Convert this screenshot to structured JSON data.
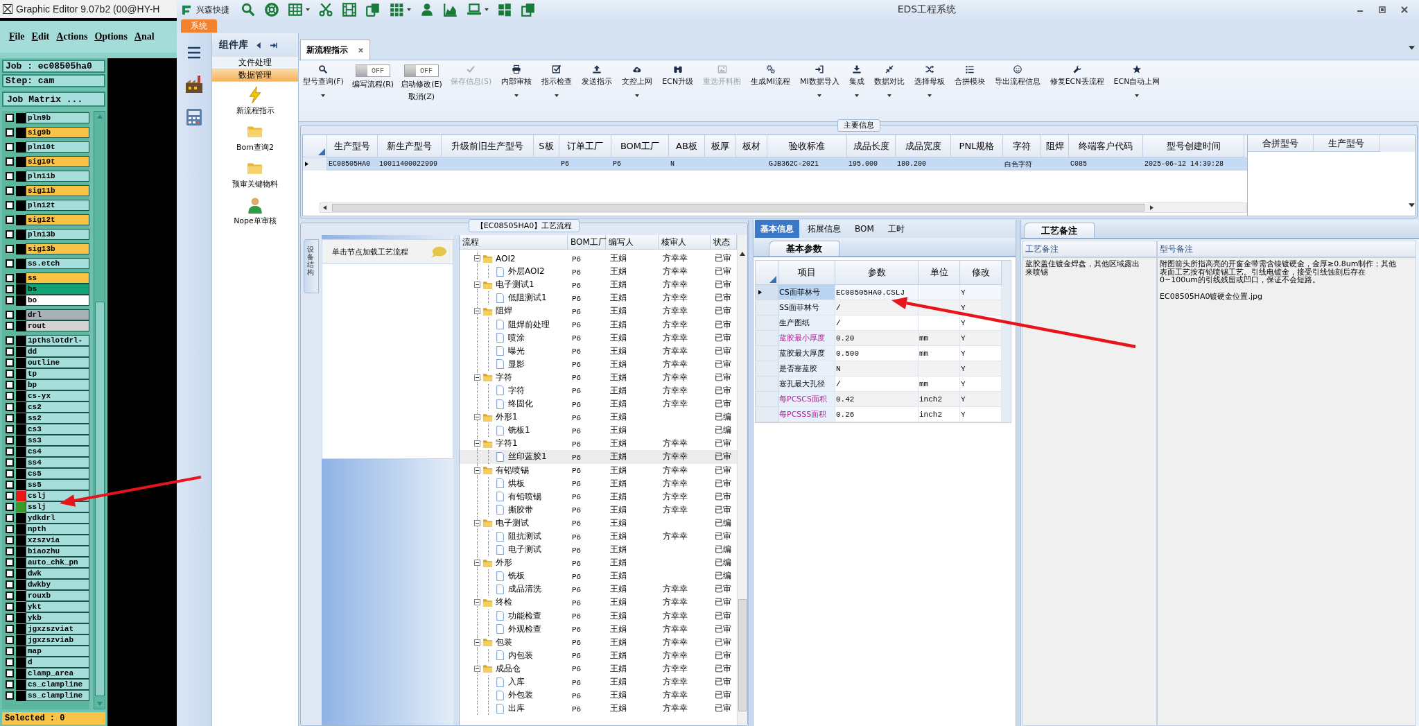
{
  "editor": {
    "title": "Graphic Editor 9.07b2 (00@HY-H",
    "menu": [
      "File",
      "Edit",
      "Actions",
      "Options",
      "Anal"
    ],
    "job": "Job : ec08505ha0",
    "step": "Step: cam",
    "matrix_button": "Job Matrix ...",
    "layer_groups": [
      [
        {
          "name": "pln9b",
          "color": "#a6dedb",
          "checked": false
        }
      ],
      [
        {
          "name": "sig9b",
          "color": "#fbc447",
          "checked": false
        }
      ],
      [
        {
          "name": "pln10t",
          "color": "#a6dedb",
          "checked": false
        }
      ],
      [
        {
          "name": "sig10t",
          "color": "#fbc447",
          "checked": false
        }
      ],
      [
        {
          "name": "pln11b",
          "color": "#a6dedb",
          "checked": false
        }
      ],
      [
        {
          "name": "sig11b",
          "color": "#fbc447",
          "checked": false
        }
      ],
      [
        {
          "name": "pln12t",
          "color": "#a6dedb",
          "checked": false
        }
      ],
      [
        {
          "name": "sig12t",
          "color": "#fbc447",
          "checked": false
        }
      ],
      [
        {
          "name": "pln13b",
          "color": "#a6dedb",
          "checked": false
        }
      ],
      [
        {
          "name": "sig13b",
          "color": "#fbc447",
          "checked": false
        }
      ],
      [
        {
          "name": "ss.etch",
          "color": "#a6dedb",
          "checked": false
        }
      ],
      [
        {
          "name": "ss",
          "color": "#fbc447",
          "checked": false
        },
        {
          "name": "bs",
          "color": "#12a273",
          "checked": false
        },
        {
          "name": "bo",
          "color": "#ffffff",
          "checked": false
        }
      ],
      [
        {
          "name": "drl",
          "color": "#a8b2b6",
          "checked": false
        },
        {
          "name": "rout",
          "color": "#d3d3d3",
          "checked": false
        }
      ],
      [
        {
          "name": "1pthslotdrl-",
          "color": "#a6dedb",
          "checked": false
        },
        {
          "name": "dd",
          "color": "#a6dedb",
          "checked": false
        },
        {
          "name": "outline",
          "color": "#a6dedb",
          "checked": false
        },
        {
          "name": "tp",
          "color": "#a6dedb",
          "checked": false
        },
        {
          "name": "bp",
          "color": "#a6dedb",
          "checked": false
        },
        {
          "name": "cs-yx",
          "color": "#a6dedb",
          "checked": false
        },
        {
          "name": "cs2",
          "color": "#a6dedb",
          "checked": false
        },
        {
          "name": "ss2",
          "color": "#a6dedb",
          "checked": false
        },
        {
          "name": "cs3",
          "color": "#a6dedb",
          "checked": false
        },
        {
          "name": "ss3",
          "color": "#a6dedb",
          "checked": false
        },
        {
          "name": "cs4",
          "color": "#a6dedb",
          "checked": false
        },
        {
          "name": "ss4",
          "color": "#a6dedb",
          "checked": false
        },
        {
          "name": "cs5",
          "color": "#a6dedb",
          "checked": false
        },
        {
          "name": "ss5",
          "color": "#a6dedb",
          "checked": false
        },
        {
          "name": "cslj",
          "color": "#a6dedb",
          "checked": false,
          "swatch": {
            "color": "#e81818"
          }
        },
        {
          "name": "sslj",
          "color": "#a6dedb",
          "checked": false,
          "swatch": {
            "color": "#3c9a28"
          }
        },
        {
          "name": "ydkdrl",
          "color": "#a6dedb",
          "checked": false
        },
        {
          "name": "npth",
          "color": "#a6dedb",
          "checked": false
        },
        {
          "name": "xzszvia",
          "color": "#a6dedb",
          "checked": false
        },
        {
          "name": "biaozhu",
          "color": "#a6dedb",
          "checked": false
        },
        {
          "name": "auto_chk_pn",
          "color": "#a6dedb",
          "checked": false
        },
        {
          "name": "dwk",
          "color": "#a6dedb",
          "checked": false
        },
        {
          "name": "dwkby",
          "color": "#a6dedb",
          "checked": false
        },
        {
          "name": "rouxb",
          "color": "#a6dedb",
          "checked": false
        },
        {
          "name": "ykt",
          "color": "#a6dedb",
          "checked": false
        },
        {
          "name": "ykb",
          "color": "#a6dedb",
          "checked": false
        },
        {
          "name": "jgxzszviat",
          "color": "#a6dedb",
          "checked": false
        },
        {
          "name": "jgxzszviab",
          "color": "#a6dedb",
          "checked": false
        },
        {
          "name": "map",
          "color": "#a6dedb",
          "checked": false
        },
        {
          "name": "d",
          "color": "#a6dedb",
          "checked": false
        },
        {
          "name": "clamp_area",
          "color": "#a6dedb",
          "checked": false
        },
        {
          "name": "cs_clampline",
          "color": "#a6dedb",
          "checked": false
        },
        {
          "name": "ss_clampline",
          "color": "#a6dedb",
          "checked": false
        }
      ]
    ],
    "status": "Selected : 0"
  },
  "app": {
    "brand": "兴森快捷",
    "title": "EDS工程系统",
    "menu_tab": "系统"
  },
  "library": {
    "title": "组件库",
    "groups": [
      {
        "label": "文件处理",
        "selected": false
      },
      {
        "label": "数据管理",
        "selected": true
      }
    ],
    "items": [
      {
        "label": "新流程指示"
      },
      {
        "label": "Bom查询2"
      },
      {
        "label": "预审关键物料"
      },
      {
        "label": "Nope单审核"
      }
    ]
  },
  "doc_tab": {
    "label": "新流程指示",
    "selected": true
  },
  "toolbar": [
    {
      "kind": "button",
      "label": "型号查询(F)",
      "dropdown": true,
      "disabled": false
    },
    {
      "kind": "toggle",
      "toggle_text": "OFF",
      "on": false,
      "label": "编写流程(R)"
    },
    {
      "kind": "toggle",
      "toggle_text": "OFF",
      "on": false,
      "label": "启动修改(E)",
      "sublabel": "取消(Z)"
    },
    {
      "kind": "button",
      "label": "保存信息(S)",
      "dropdown": false,
      "disabled": true
    },
    {
      "kind": "button",
      "label": "内部审核",
      "dropdown": true,
      "disabled": false
    },
    {
      "kind": "button",
      "label": "指示检查",
      "dropdown": true,
      "disabled": false
    },
    {
      "kind": "button",
      "label": "发送指示",
      "dropdown": false,
      "disabled": false
    },
    {
      "kind": "button",
      "label": "文控上网",
      "dropdown": true,
      "disabled": false
    },
    {
      "kind": "button",
      "label": "ECN升级",
      "dropdown": false,
      "disabled": false
    },
    {
      "kind": "button",
      "label": "重选开料图",
      "dropdown": false,
      "disabled": true
    },
    {
      "kind": "button",
      "label": "生成MI流程",
      "dropdown": false,
      "disabled": false
    },
    {
      "kind": "button",
      "label": "MI数据导入",
      "dropdown": true,
      "disabled": false
    },
    {
      "kind": "button",
      "label": "集成",
      "dropdown": true,
      "disabled": false
    },
    {
      "kind": "button",
      "label": "数据对比",
      "dropdown": true,
      "disabled": false
    },
    {
      "kind": "button",
      "label": "选择母板",
      "dropdown": true,
      "disabled": false
    },
    {
      "kind": "button",
      "label": "合拼模块",
      "dropdown": false,
      "disabled": false
    },
    {
      "kind": "button",
      "label": "导出流程信息",
      "dropdown": false,
      "disabled": false
    },
    {
      "kind": "button",
      "label": "修复ECN丢流程",
      "dropdown": false,
      "disabled": false
    },
    {
      "kind": "button",
      "label": "ECN自动上网",
      "dropdown": true,
      "disabled": false
    }
  ],
  "main_info": {
    "title": "主要信息",
    "columns": [
      "生产型号",
      "新生产型号",
      "升级前旧生产型号",
      "S板",
      "订单工厂",
      "BOM工厂",
      "AB板",
      "板厚",
      "板材",
      "验收标准",
      "成品长度",
      "成品宽度",
      "PNL规格",
      "字符",
      "阻焊",
      "终端客户代码",
      "型号创建时间"
    ],
    "rows": [
      {
        "selected": true,
        "cells": [
          "EC08505HA0",
          "10011400022999",
          null,
          null,
          "P6",
          "P6",
          "N",
          null,
          null,
          "GJB362C-2021",
          "195.000",
          "180.200",
          null,
          "白色字符",
          null,
          "C085",
          "2025-06-12 14:39:28"
        ]
      }
    ],
    "side_columns": [
      "合拼型号",
      "生产型号"
    ]
  },
  "process": {
    "title": "【EC08505HA0】工艺流程",
    "side_tab": "设备结构",
    "hint": "单击节点加载工艺流程",
    "columns": [
      "流程",
      "BOM工厂",
      "编写人",
      "核审人",
      "状态"
    ],
    "nodes": [
      {
        "name": "AOI2",
        "bom": "P6",
        "writer": "王娟",
        "reviewer": "方幸幸",
        "status": "已审",
        "expanded": true,
        "selected": false,
        "children": [
          {
            "name": "外层AOI2",
            "bom": "P6",
            "writer": "王娟",
            "reviewer": "方幸幸",
            "status": "已审",
            "selected": false
          }
        ]
      },
      {
        "name": "电子测试1",
        "bom": "P6",
        "writer": "王娟",
        "reviewer": "方幸幸",
        "status": "已审",
        "expanded": true,
        "selected": false,
        "children": [
          {
            "name": "低阻测试1",
            "bom": "P6",
            "writer": "王娟",
            "reviewer": "方幸幸",
            "status": "已审",
            "selected": false
          }
        ]
      },
      {
        "name": "阻焊",
        "bom": "P6",
        "writer": "王娟",
        "reviewer": "方幸幸",
        "status": "已审",
        "expanded": true,
        "selected": false,
        "children": [
          {
            "name": "阻焊前处理",
            "bom": "P6",
            "writer": "王娟",
            "reviewer": "方幸幸",
            "status": "已审",
            "selected": false
          },
          {
            "name": "喷涂",
            "bom": "P6",
            "writer": "王娟",
            "reviewer": "方幸幸",
            "status": "已审",
            "selected": false
          },
          {
            "name": "曝光",
            "bom": "P6",
            "writer": "王娟",
            "reviewer": "方幸幸",
            "status": "已审",
            "selected": false
          },
          {
            "name": "显影",
            "bom": "P6",
            "writer": "王娟",
            "reviewer": "方幸幸",
            "status": "已审",
            "selected": false
          }
        ]
      },
      {
        "name": "字符",
        "bom": "P6",
        "writer": "王娟",
        "reviewer": "方幸幸",
        "status": "已审",
        "expanded": true,
        "selected": false,
        "children": [
          {
            "name": "字符",
            "bom": "P6",
            "writer": "王娟",
            "reviewer": "方幸幸",
            "status": "已审",
            "selected": false
          },
          {
            "name": "终固化",
            "bom": "P6",
            "writer": "王娟",
            "reviewer": "方幸幸",
            "status": "已审",
            "selected": false
          }
        ]
      },
      {
        "name": "外形1",
        "bom": "P6",
        "writer": "王娟",
        "status": "已编",
        "expanded": true,
        "selected": false,
        "children": [
          {
            "name": "铣板1",
            "bom": "P6",
            "writer": "王娟",
            "status": "已编",
            "selected": false
          }
        ]
      },
      {
        "name": "字符1",
        "bom": "P6",
        "writer": "王娟",
        "reviewer": "方幸幸",
        "status": "已审",
        "expanded": true,
        "selected": false,
        "children": [
          {
            "name": "丝印蓝胶1",
            "bom": "P6",
            "writer": "王娟",
            "reviewer": "方幸幸",
            "status": "已审",
            "selected": true
          }
        ]
      },
      {
        "name": "有铅喷锡",
        "bom": "P6",
        "writer": "王娟",
        "reviewer": "方幸幸",
        "status": "已审",
        "expanded": true,
        "selected": false,
        "children": [
          {
            "name": "烘板",
            "bom": "P6",
            "writer": "王娟",
            "reviewer": "方幸幸",
            "status": "已审",
            "selected": false
          },
          {
            "name": "有铅喷锡",
            "bom": "P6",
            "writer": "王娟",
            "reviewer": "方幸幸",
            "status": "已审",
            "selected": false
          },
          {
            "name": "撕胶带",
            "bom": "P6",
            "writer": "王娟",
            "reviewer": "方幸幸",
            "status": "已审",
            "selected": false
          }
        ]
      },
      {
        "name": "电子测试",
        "bom": "P6",
        "writer": "王娟",
        "status": "已编",
        "expanded": true,
        "selected": false,
        "children": [
          {
            "name": "阻抗测试",
            "bom": "P6",
            "writer": "王娟",
            "reviewer": "方幸幸",
            "status": "已审",
            "selected": false
          },
          {
            "name": "电子测试",
            "bom": "P6",
            "writer": "王娟",
            "status": "已编",
            "selected": false
          }
        ]
      },
      {
        "name": "外形",
        "bom": "P6",
        "writer": "王娟",
        "status": "已编",
        "expanded": true,
        "selected": false,
        "children": [
          {
            "name": "铣板",
            "bom": "P6",
            "writer": "王娟",
            "status": "已编",
            "selected": false
          },
          {
            "name": "成品清洗",
            "bom": "P6",
            "writer": "王娟",
            "reviewer": "方幸幸",
            "status": "已审",
            "selected": false
          }
        ]
      },
      {
        "name": "终检",
        "bom": "P6",
        "writer": "王娟",
        "reviewer": "方幸幸",
        "status": "已审",
        "expanded": true,
        "selected": false,
        "children": [
          {
            "name": "功能检查",
            "bom": "P6",
            "writer": "王娟",
            "reviewer": "方幸幸",
            "status": "已审",
            "selected": false
          },
          {
            "name": "外观检查",
            "bom": "P6",
            "writer": "王娟",
            "reviewer": "方幸幸",
            "status": "已审",
            "selected": false
          }
        ]
      },
      {
        "name": "包装",
        "bom": "P6",
        "writer": "王娟",
        "reviewer": "方幸幸",
        "status": "已审",
        "expanded": true,
        "selected": false,
        "children": [
          {
            "name": "内包装",
            "bom": "P6",
            "writer": "王娟",
            "reviewer": "方幸幸",
            "status": "已审",
            "selected": false
          }
        ]
      },
      {
        "name": "成品仓",
        "bom": "P6",
        "writer": "王娟",
        "reviewer": "方幸幸",
        "status": "已审",
        "expanded": true,
        "selected": false,
        "children": [
          {
            "name": "入库",
            "bom": "P6",
            "writer": "王娟",
            "reviewer": "方幸幸",
            "status": "已审",
            "selected": false
          },
          {
            "name": "外包装",
            "bom": "P6",
            "writer": "王娟",
            "reviewer": "方幸幸",
            "status": "已审",
            "selected": false
          },
          {
            "name": "出库",
            "bom": "P6",
            "writer": "王娟",
            "reviewer": "方幸幸",
            "status": "已审",
            "selected": false
          }
        ]
      }
    ]
  },
  "detail_tabs": [
    {
      "label": "基本信息",
      "selected": true
    },
    {
      "label": "拓展信息",
      "selected": false
    },
    {
      "label": "BOM",
      "selected": false
    },
    {
      "label": "工时",
      "selected": false
    }
  ],
  "params": {
    "tab": "基本参数",
    "columns": [
      "项目",
      "参数",
      "单位",
      "修改"
    ],
    "rows": [
      {
        "item": "CS面菲林号",
        "highlighted": false,
        "value": "EC08505HA0.CSLJ",
        "unit": null,
        "modify": "Y",
        "selected": true
      },
      {
        "item": "SS面菲林号",
        "highlighted": false,
        "value": "/",
        "unit": null,
        "modify": "Y",
        "selected": false
      },
      {
        "item": "生产图纸",
        "highlighted": false,
        "value": "/",
        "unit": null,
        "modify": "Y",
        "selected": false
      },
      {
        "item": "蓝胶最小厚度",
        "highlighted": true,
        "value": "0.20",
        "unit": "mm",
        "modify": "Y",
        "selected": false
      },
      {
        "item": "蓝胶最大厚度",
        "highlighted": false,
        "value": "0.500",
        "unit": "mm",
        "modify": "Y",
        "selected": false
      },
      {
        "item": "是否塞蓝胶",
        "highlighted": false,
        "value": "N",
        "unit": null,
        "modify": "Y",
        "selected": false
      },
      {
        "item": "塞孔最大孔径",
        "highlighted": false,
        "value": "/",
        "unit": "mm",
        "modify": "Y",
        "selected": false
      },
      {
        "item": "每PCSCS面积",
        "highlighted": true,
        "value": "0.42",
        "unit": "inch2",
        "modify": "Y",
        "selected": false
      },
      {
        "item": "每PCSSS面积",
        "highlighted": true,
        "value": "0.26",
        "unit": "inch2",
        "modify": "Y",
        "selected": false
      }
    ]
  },
  "notes": {
    "tab": "工艺备注",
    "columns": [
      "工艺备注",
      "型号备注"
    ],
    "process_note": "蓝胶盖住镀金焊盘，其他区域露出来喷锡",
    "model_note": [
      "附图箭头所指高亮的开窗金带需含镍镀硬金，金厚≥0.8um制作；其他表面工艺按有铅喷锡工艺。引线电镀金，接受引线蚀刻后存在0~100um的引线残留或凹口，保证不会短路。",
      "EC08505HA0镀硬金位置.jpg"
    ]
  }
}
